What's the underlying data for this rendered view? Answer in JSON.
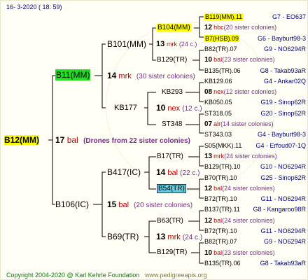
{
  "header": {
    "date": "16-  3-2020 ( 18: 59)"
  },
  "footer": {
    "copyright": "Copyright 2004-2020 @ Karl Kehrle Foundation",
    "url": "www.pedigreeapis.org"
  },
  "root": {
    "id": "B12(MM)",
    "num": "17",
    "race": "bal",
    "note": "(Drones from 22 sister colonies)"
  },
  "gen1": [
    {
      "id": "B11(MM)",
      "num": "14",
      "race": "mrk",
      "note": "(30 sister colonies)"
    },
    {
      "id": "B106(IC)",
      "num": "15",
      "race": "bal",
      "note": "(20 sister colonies)"
    }
  ],
  "gen2": [
    {
      "id": "B101(MM)"
    },
    {
      "id": "KB177",
      "num": "10",
      "race": "nex",
      "note": "(12 c.)"
    },
    {
      "id": "B417(IC)",
      "num": "14",
      "race": "bal",
      "note": "(22 c.)"
    },
    {
      "id": "B69(TR)",
      "num": "13",
      "race": "mrk",
      "note": "(24 c.)"
    }
  ],
  "gen3": [
    {
      "id": "B104(MM)",
      "num": "13",
      "race": "mrk",
      "note": "(24 c.)"
    },
    {
      "id": "B129(TR)"
    },
    {
      "id": "KB293"
    },
    {
      "id": "ST348"
    },
    {
      "id": "B17(TR)"
    },
    {
      "id": "B54(TR)"
    },
    {
      "id": "B63(TR)"
    },
    {
      "id": "B129(TR)"
    }
  ],
  "gen4": [
    {
      "id": "B119(MM).11",
      "right": "G7 - EO637"
    },
    {
      "num": "12",
      "race": "hbc",
      "note": "(20 sister colonies)"
    },
    {
      "id": "B7(HSB).09",
      "right": "G6 - Bayburt98-3"
    },
    {
      "id": "B82(TR).07",
      "right": "G9 - NO6294R"
    },
    {
      "num": "10",
      "race": "bal",
      "note": "(23 sister colonies)"
    },
    {
      "id": "B135(TR).06",
      "right": "G8 - Takab93aR"
    },
    {
      "id": "KB129.06",
      "right": "G4 - Ankar02Q"
    },
    {
      "num": "08",
      "race": "nex",
      "note": "(12 sister colonies)"
    },
    {
      "id": "KB050.05",
      "right": "G19 - Sinop62R"
    },
    {
      "id": "ST318.05",
      "right": "G20 - Sinop62R"
    },
    {
      "num": "07",
      "race": "alr",
      "note": "(14 sister colonies)"
    },
    {
      "id": "ST343.03",
      "right": "G4 - Bayburt98-3"
    },
    {
      "id": "S05(MKK).11",
      "right": "G4 - Erfoud07-1Q"
    },
    {
      "num": "13",
      "race": "mrk",
      "note": "(24 sister colonies)"
    },
    {
      "id": "B129(TR).10",
      "right": "G10 - NO6294R"
    },
    {
      "id": "B70(TR).10",
      "right": "G25 - Sinop62R"
    },
    {
      "num": "12",
      "race": "bal",
      "note": "(24 sister colonies)"
    },
    {
      "id": "B72(TR).10",
      "right": "G11 - NO6294R"
    },
    {
      "id": "B137(TR).11",
      "right": "G8 - Kangaroo98R"
    },
    {
      "num": "12",
      "race": "bal",
      "note": "(24 sister colonies)"
    },
    {
      "id": "B72(TR).10",
      "right": "G11 - NO6294R"
    },
    {
      "id": "B82(TR).07",
      "right": "G9 - NO6294R"
    },
    {
      "num": "10",
      "race": "bal",
      "note": "(23 sister colonies)"
    },
    {
      "id": "B135(TR).06",
      "right": "G8 - Takab93aR"
    }
  ],
  "colors": {
    "yellow": "#ffff00",
    "green": "#22dd22",
    "cyan": "#66ccdd",
    "navy": "#000080",
    "red": "#c00000",
    "purple": "#7a2a8c"
  }
}
